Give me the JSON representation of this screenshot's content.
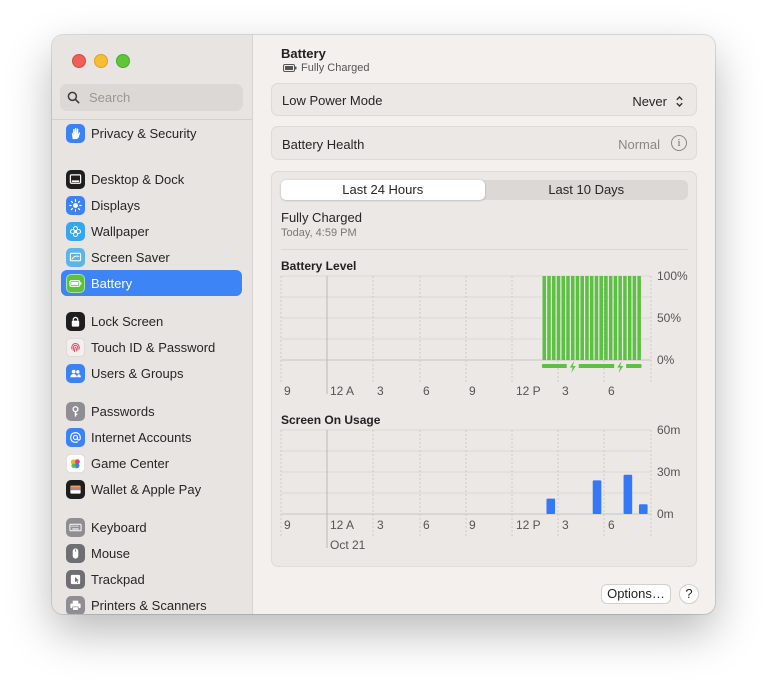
{
  "window": {
    "title": "Battery"
  },
  "sidebar": {
    "search_placeholder": "Search",
    "items": [
      {
        "label": "Privacy & Security",
        "icon": "hand-icon",
        "color": "#3b82f6"
      },
      {
        "label": "Desktop & Dock",
        "icon": "dock-icon",
        "color": "#1e1e1e"
      },
      {
        "label": "Displays",
        "icon": "sun-icon",
        "color": "#3b82f6"
      },
      {
        "label": "Wallpaper",
        "icon": "flower-icon",
        "color": "#35a7f0"
      },
      {
        "label": "Screen Saver",
        "icon": "screensaver-icon",
        "color": "#5bb6e6"
      },
      {
        "label": "Battery",
        "icon": "battery-icon",
        "color": "#5cc143"
      },
      {
        "label": "Lock Screen",
        "icon": "lock-icon",
        "color": "#1e1e1e"
      },
      {
        "label": "Touch ID & Password",
        "icon": "fingerprint-icon",
        "color": "#f2f0ee"
      },
      {
        "label": "Users & Groups",
        "icon": "users-icon",
        "color": "#3b82f6"
      },
      {
        "label": "Passwords",
        "icon": "key-icon",
        "color": "#8e8e93"
      },
      {
        "label": "Internet Accounts",
        "icon": "at-icon",
        "color": "#3b82f6"
      },
      {
        "label": "Game Center",
        "icon": "game-center-icon",
        "color": "#ffffff"
      },
      {
        "label": "Wallet & Apple Pay",
        "icon": "wallet-icon",
        "color": "#1e1e1e"
      },
      {
        "label": "Keyboard",
        "icon": "keyboard-icon",
        "color": "#8e8e93"
      },
      {
        "label": "Mouse",
        "icon": "mouse-icon",
        "color": "#6e6e73"
      },
      {
        "label": "Trackpad",
        "icon": "trackpad-icon",
        "color": "#6e6e73"
      },
      {
        "label": "Printers & Scanners",
        "icon": "printer-icon",
        "color": "#8e8e93"
      }
    ],
    "active_index": 5
  },
  "header": {
    "title": "Battery",
    "subtitle": "Fully Charged"
  },
  "settings": {
    "low_power_label": "Low Power Mode",
    "low_power_value": "Never",
    "health_label": "Battery Health",
    "health_value": "Normal",
    "info_symbol": "i"
  },
  "usage": {
    "tabs": [
      "Last 24 Hours",
      "Last 10 Days"
    ],
    "active_tab": 0,
    "status_title": "Fully Charged",
    "status_time": "Today, 4:59 PM"
  },
  "footer": {
    "options_label": "Options…",
    "help_label": "?"
  },
  "colors": {
    "accent": "#3d84f6",
    "battery_green": "#5cc143",
    "usage_blue": "#3478f6"
  },
  "chart_data": [
    {
      "type": "bar",
      "title": "Battery Level",
      "x_tick_labels": [
        "9",
        "12 A",
        "3",
        "6",
        "9",
        "12 P",
        "3",
        "6"
      ],
      "y_tick_labels": [
        "100%",
        "50%",
        "0%"
      ],
      "ylim": [
        0,
        100
      ],
      "unit": "%",
      "bars": [
        {
          "slot": 55,
          "value": 100
        },
        {
          "slot": 56,
          "value": 100
        },
        {
          "slot": 57,
          "value": 100
        },
        {
          "slot": 58,
          "value": 100
        },
        {
          "slot": 59,
          "value": 100
        },
        {
          "slot": 60,
          "value": 100
        },
        {
          "slot": 61,
          "value": 100
        },
        {
          "slot": 62,
          "value": 100
        },
        {
          "slot": 63,
          "value": 100
        },
        {
          "slot": 64,
          "value": 100
        },
        {
          "slot": 65,
          "value": 100
        },
        {
          "slot": 66,
          "value": 100
        },
        {
          "slot": 67,
          "value": 100
        },
        {
          "slot": 68,
          "value": 100
        },
        {
          "slot": 69,
          "value": 100
        },
        {
          "slot": 70,
          "value": 100
        },
        {
          "slot": 71,
          "value": 100
        },
        {
          "slot": 72,
          "value": 100
        },
        {
          "slot": 73,
          "value": 100
        },
        {
          "slot": 74,
          "value": 100
        },
        {
          "slot": 75,
          "value": 100
        }
      ],
      "charging_bolts": [
        61,
        71
      ],
      "slots_total": 78
    },
    {
      "type": "bar",
      "title": "Screen On Usage",
      "x_tick_labels": [
        "9",
        "12 A",
        "3",
        "6",
        "9",
        "12 P",
        "3",
        "6"
      ],
      "date_label": "Oct 21",
      "y_tick_labels": [
        "60m",
        "30m",
        "0m"
      ],
      "ylim": [
        0,
        60
      ],
      "unit": "minutes",
      "bars": [
        {
          "hour_index": 17,
          "value": 11
        },
        {
          "hour_index": 20,
          "value": 24
        },
        {
          "hour_index": 22,
          "value": 28
        },
        {
          "hour_index": 23,
          "value": 7
        }
      ],
      "hours_total": 24
    }
  ]
}
